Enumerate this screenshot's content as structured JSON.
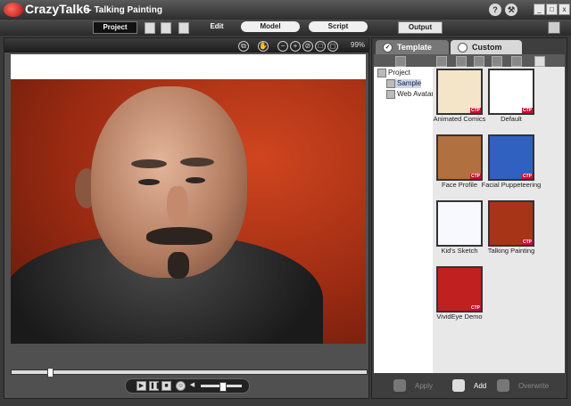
{
  "app": {
    "logo_text": "CrazyTalk6",
    "window_title": "-- Talking Painting"
  },
  "titlebar": {
    "help_label": "?",
    "win_min_label": "_",
    "win_max_label": "□",
    "win_close_label": "x"
  },
  "toolbar": {
    "project_label": "Project",
    "modes": [
      {
        "label": "Edit"
      },
      {
        "label": "Model"
      },
      {
        "label": "Script"
      }
    ],
    "output_label": "Output"
  },
  "viewer": {
    "zoom_label": "99%",
    "tools": [
      {
        "name": "fit-icon",
        "glyph": "⧉"
      },
      {
        "name": "hand-icon",
        "glyph": "✋"
      },
      {
        "name": "zoom-out-icon",
        "glyph": "−"
      },
      {
        "name": "zoom-in-icon",
        "glyph": "+"
      },
      {
        "name": "no-zoom-icon",
        "glyph": "⊘"
      },
      {
        "name": "frame-icon",
        "glyph": "□"
      },
      {
        "name": "actual-size-icon",
        "glyph": "◻"
      }
    ]
  },
  "playback": {
    "progress_fraction": 0.1,
    "volume_fraction": 0.45
  },
  "right_panel": {
    "tabs": [
      {
        "label": "Template",
        "active": true
      },
      {
        "label": "Custom",
        "active": false
      }
    ],
    "tree": [
      {
        "label": "Project",
        "level": 0,
        "selected": false
      },
      {
        "label": "Sample",
        "level": 1,
        "selected": true
      },
      {
        "label": "Web Avatar",
        "level": 1,
        "selected": false
      }
    ],
    "templates": [
      {
        "label": "Animated Comics",
        "ctp": "CTP",
        "color": "#f4e4c8"
      },
      {
        "label": "Default",
        "ctp": "CTP",
        "color": "#ffffff"
      },
      {
        "label": "Face Profile",
        "ctp": "CTP",
        "color": "#b07040"
      },
      {
        "label": "Facial Puppeteering",
        "ctp": "CTP",
        "color": "#3060c0"
      },
      {
        "label": "Kid's Sketch",
        "ctp": "",
        "color": "#f8f8ff"
      },
      {
        "label": "Talking Painting",
        "ctp": "CTP",
        "color": "#a83418"
      },
      {
        "label": "VividEye Demo",
        "ctp": "CTP",
        "color": "#c02020"
      }
    ],
    "actions": [
      {
        "label": "Apply",
        "enabled": false
      },
      {
        "label": "Add",
        "enabled": true
      },
      {
        "label": "Overwrite",
        "enabled": false
      }
    ]
  },
  "colors": {
    "accent_red": "#c8102e",
    "selection": "#c8d6f0"
  }
}
